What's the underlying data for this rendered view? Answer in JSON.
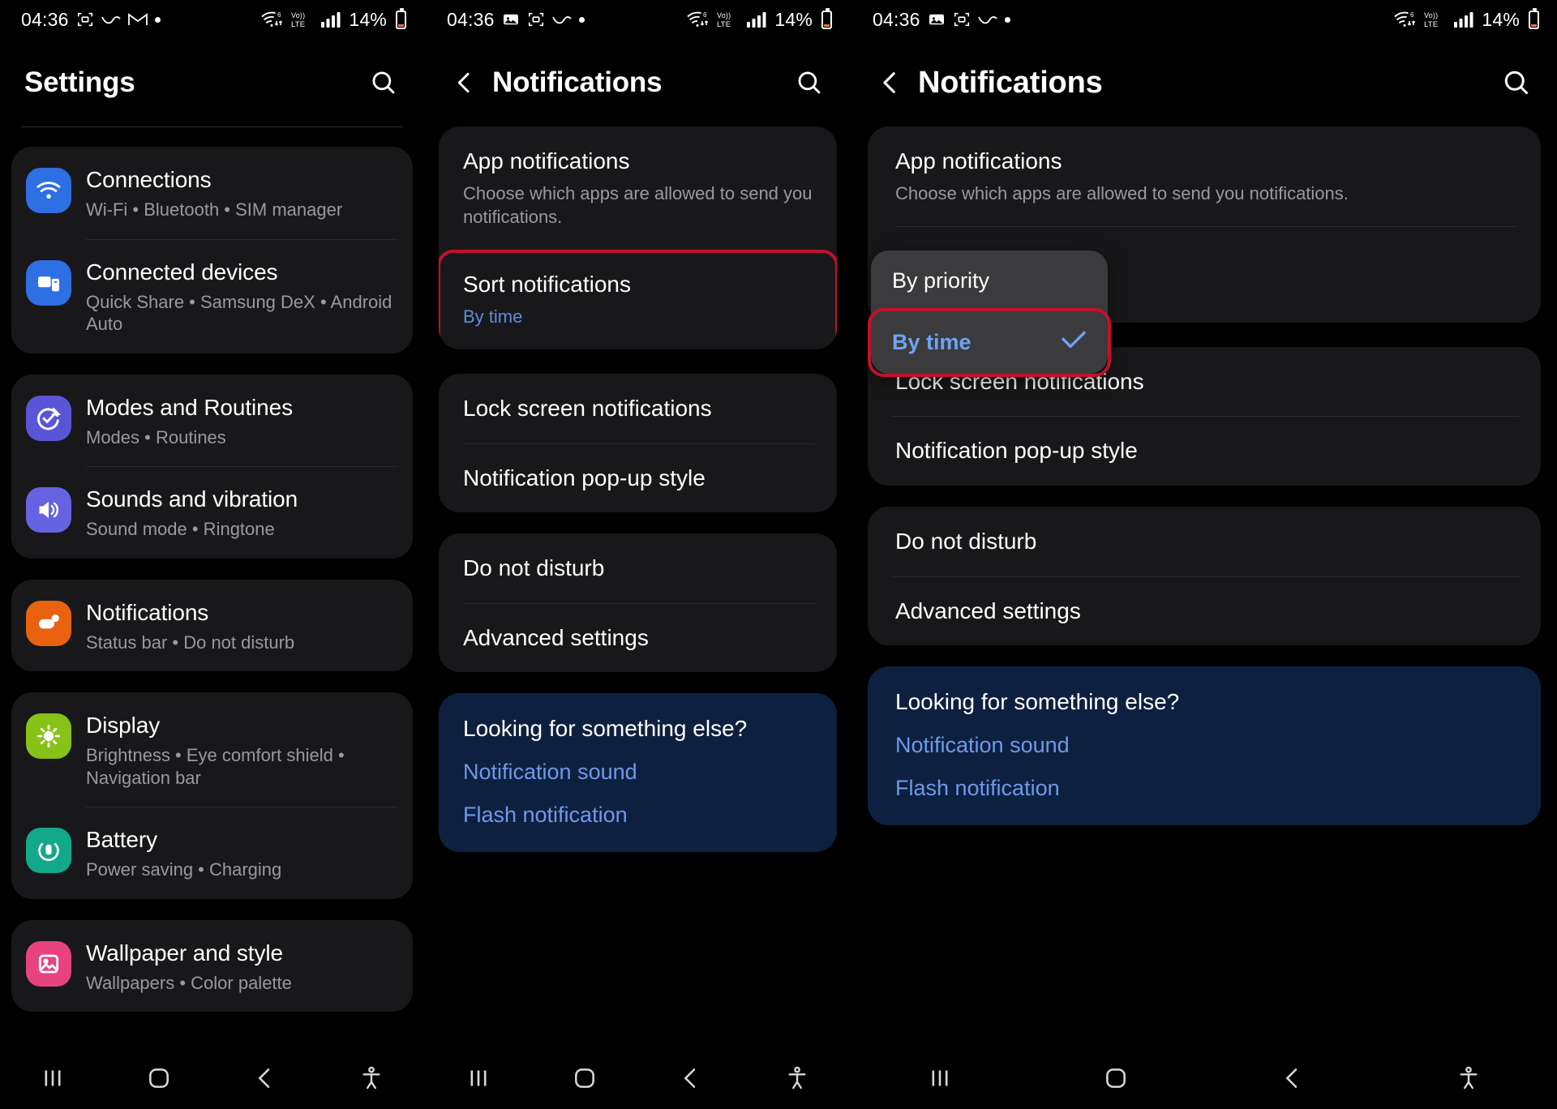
{
  "status_bar": {
    "time": "04:36",
    "battery_percent": "14%",
    "network": "LTE",
    "wifi_label": "6",
    "volte_label": "VoLTE",
    "icons": [
      "screenshot-icon",
      "swipe-icon",
      "gmail-icon",
      "dot-icon",
      "wifi-icon",
      "volte-icon",
      "signal-icon",
      "battery-icon"
    ]
  },
  "colors": {
    "accent_blue": "#5b8fe0",
    "highlight_red": "#c2102e",
    "card_bg": "#18181a",
    "blue_card_bg": "#0e2040",
    "popup_bg": "#3b3b3e"
  },
  "panel1": {
    "title": "Settings",
    "search_icon": "search-icon",
    "groups": [
      {
        "items": [
          {
            "label": "Connections",
            "sub": "Wi-Fi  •  Bluetooth  •  SIM manager",
            "icon": "wifi-icon",
            "icon_color": "#2f6fe4"
          },
          {
            "label": "Connected devices",
            "sub": "Quick Share  •  Samsung DeX  •  Android Auto",
            "icon": "devices-icon",
            "icon_color": "#2f6fe4"
          }
        ]
      },
      {
        "items": [
          {
            "label": "Modes and Routines",
            "sub": "Modes  •  Routines",
            "icon": "modes-icon",
            "icon_color": "#5a55d6"
          },
          {
            "label": "Sounds and vibration",
            "sub": "Sound mode  •  Ringtone",
            "icon": "sound-icon",
            "icon_color": "#6663e0"
          }
        ]
      },
      {
        "highlighted": true,
        "items": [
          {
            "label": "Notifications",
            "sub": "Status bar  •  Do not disturb",
            "icon": "notifications-icon",
            "icon_color": "#e8620f"
          }
        ]
      },
      {
        "items": [
          {
            "label": "Display",
            "sub": "Brightness  •  Eye comfort shield  •  Navigation bar",
            "icon": "brightness-icon",
            "icon_color": "#86c217"
          },
          {
            "label": "Battery",
            "sub": "Power saving  •  Charging",
            "icon": "battery-settings-icon",
            "icon_color": "#14a88b"
          }
        ]
      },
      {
        "items": [
          {
            "label": "Wallpaper and style",
            "sub": "Wallpapers  •  Color palette",
            "icon": "wallpaper-icon",
            "icon_color": "#e8437e"
          }
        ]
      }
    ]
  },
  "panel2": {
    "title": "Notifications",
    "back_icon": "back-chevron-icon",
    "search_icon": "search-icon",
    "card1": [
      {
        "label": "App notifications",
        "sub": "Choose which apps are allowed to send you notifications.",
        "sub_accent": false
      },
      {
        "label": "Sort notifications",
        "sub": "By time",
        "sub_accent": true,
        "highlighted": true
      }
    ],
    "card2": [
      {
        "label": "Lock screen notifications"
      },
      {
        "label": "Notification pop-up style"
      }
    ],
    "card3": [
      {
        "label": "Do not disturb"
      },
      {
        "label": "Advanced settings"
      }
    ],
    "blue_card": {
      "title": "Looking for something else?",
      "links": [
        "Notification sound",
        "Flash notification"
      ]
    }
  },
  "panel3": {
    "title": "Notifications",
    "back_icon": "back-chevron-icon",
    "search_icon": "search-icon",
    "card1": [
      {
        "label": "App notifications",
        "sub": "Choose which apps are allowed to send you notifications.",
        "sub_accent": false
      }
    ],
    "popup": {
      "options": [
        {
          "label": "By priority",
          "selected": false
        },
        {
          "label": "By time",
          "selected": true,
          "check_icon": "check-icon",
          "highlighted": true
        }
      ]
    },
    "card2": [
      {
        "label": "Lock screen notifications"
      },
      {
        "label": "Notification pop-up style"
      }
    ],
    "card3": [
      {
        "label": "Do not disturb"
      },
      {
        "label": "Advanced settings"
      }
    ],
    "blue_card": {
      "title": "Looking for something else?",
      "links": [
        "Notification sound",
        "Flash notification"
      ]
    }
  },
  "nav_bar": {
    "items": [
      "recents-icon",
      "home-icon",
      "back-icon",
      "accessibility-icon"
    ]
  }
}
